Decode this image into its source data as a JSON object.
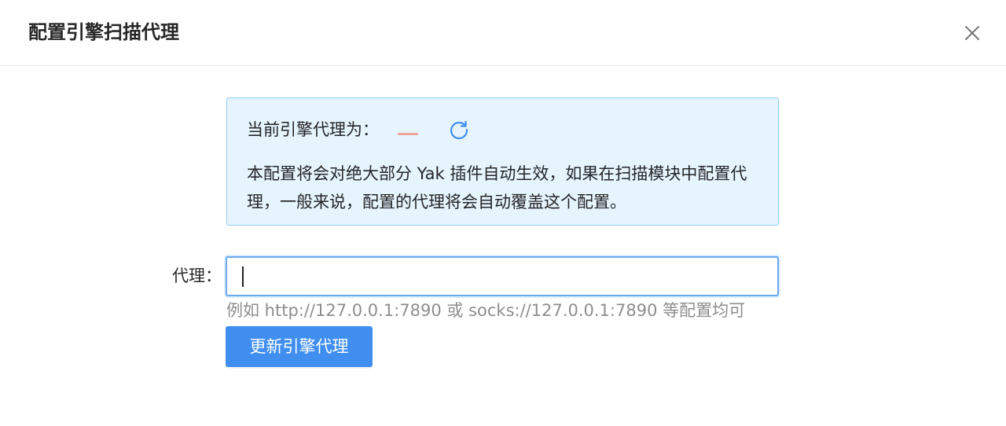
{
  "modal": {
    "title": "配置引擎扫描代理",
    "close_icon": "close-icon"
  },
  "alert": {
    "current_proxy_label": "当前引擎代理为：",
    "current_proxy_value": "",
    "refresh_icon": "refresh-icon",
    "description": "本配置将会对绝大部分 Yak 插件自动生效，如果在扫描模块中配置代理，一般来说，配置的代理将会自动覆盖这个配置。"
  },
  "form": {
    "proxy_label": "代理：",
    "proxy_value": "",
    "proxy_placeholder": "",
    "help_text": "例如 http://127.0.0.1:7890 或 socks://127.0.0.1:7890 等配置均可",
    "submit_label": "更新引擎代理"
  },
  "colors": {
    "primary": "#3f8ef0",
    "alert_background": "#e6f4fd",
    "alert_border": "#91cdf5",
    "empty_value_dash": "#f0a59a"
  }
}
